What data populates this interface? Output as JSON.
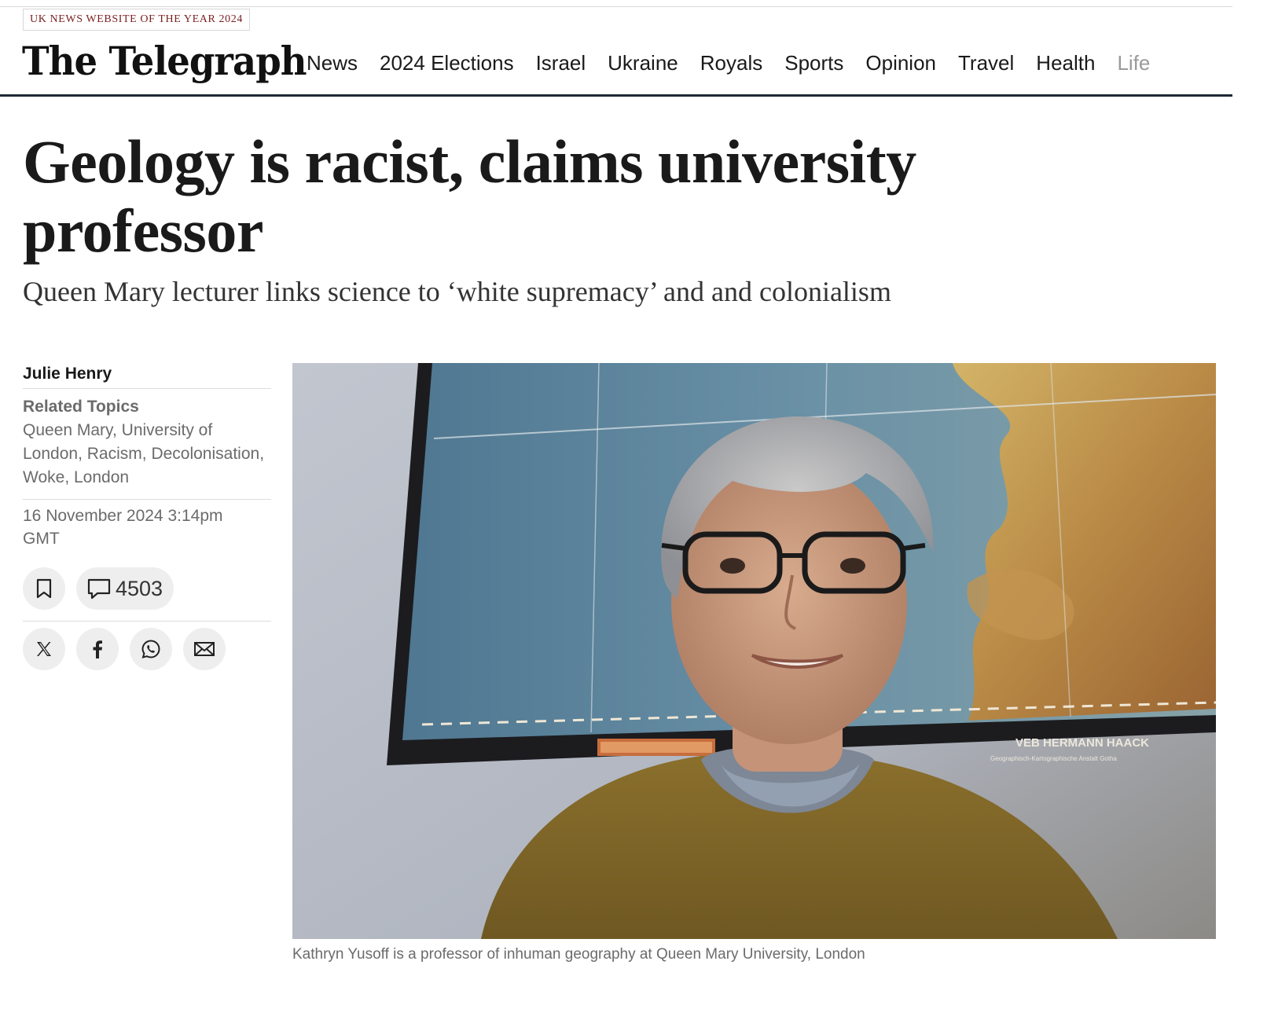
{
  "header": {
    "award_text": "UK NEWS WEBSITE OF THE YEAR 2024",
    "logo_text": "The Telegraph",
    "nav": [
      "News",
      "2024 Elections",
      "Israel",
      "Ukraine",
      "Royals",
      "Sports",
      "Opinion",
      "Travel",
      "Health",
      "Life"
    ]
  },
  "article": {
    "headline": "Geology is racist, claims university professor",
    "standfirst": "Queen Mary lecturer links science to ‘white supremacy’ and and colonialism",
    "author": "Julie Henry",
    "related_title": "Related Topics",
    "topics": [
      "Queen Mary, University of London",
      "Racism",
      "Decolonisation",
      "Woke",
      "London"
    ],
    "date": "16 November 2024 3:14pm",
    "timezone": "GMT",
    "comment_count": "4503",
    "image_map_label": "VEB HERMANN HAACK",
    "image_map_sublabel": "Geographisch-Kartographische Anstalt Gotha",
    "caption": "Kathryn Yusoff is a professor of inhuman geography at Queen Mary University, London"
  },
  "icons": {
    "bookmark": "bookmark-icon",
    "comments": "comment-icon",
    "share": [
      "x-icon",
      "facebook-icon",
      "whatsapp-icon",
      "email-icon"
    ]
  },
  "colors": {
    "award_text": "#7a1e1e",
    "header_rule": "#1e2933",
    "meta_text": "#6b6b6b"
  }
}
